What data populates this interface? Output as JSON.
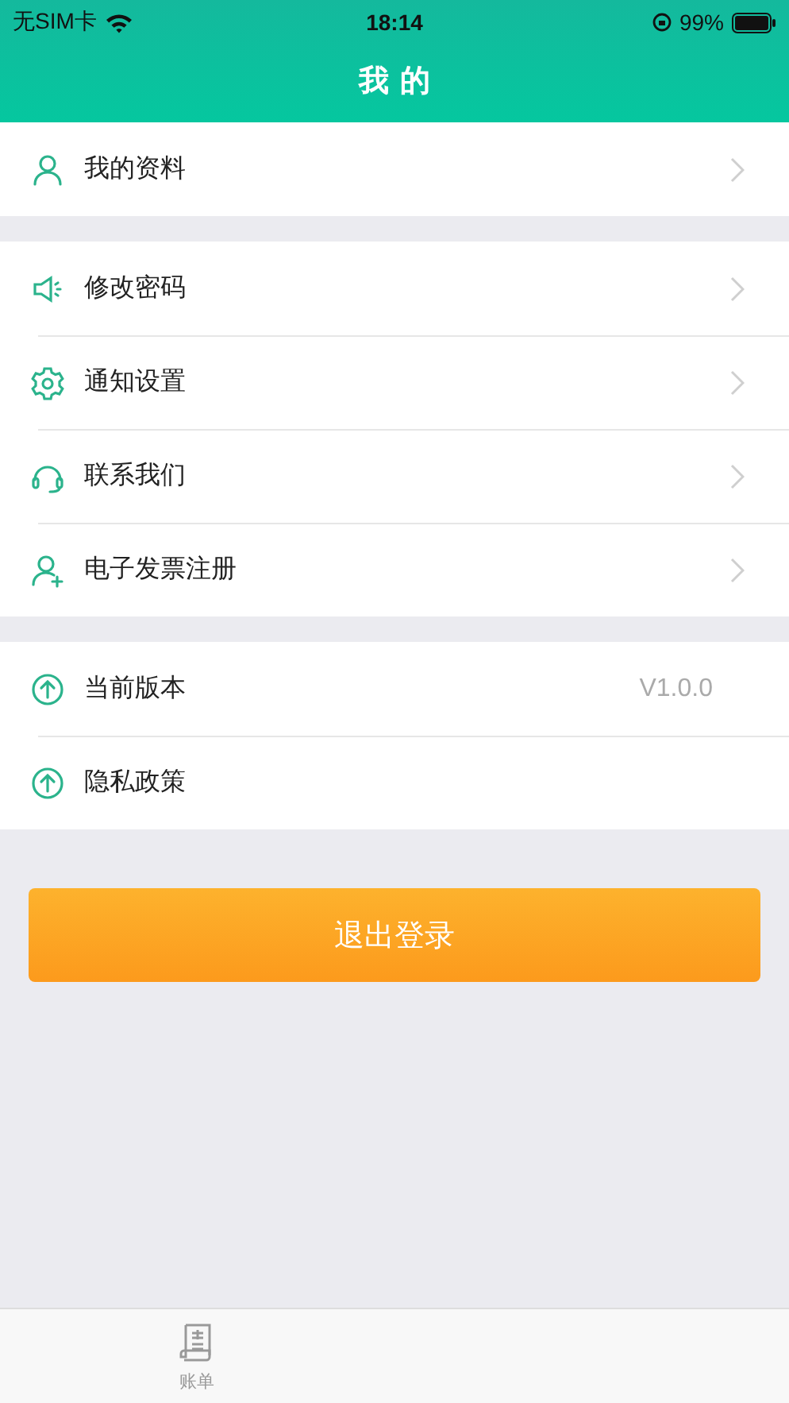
{
  "status_bar": {
    "carrier": "无SIM卡",
    "time": "18:14",
    "battery": "99%"
  },
  "header": {
    "title": "我 的"
  },
  "groups": [
    {
      "items": [
        {
          "label": "我的资料",
          "kind": "link"
        }
      ]
    },
    {
      "items": [
        {
          "label": "修改密码",
          "kind": "link"
        },
        {
          "label": "通知设置",
          "kind": "link"
        },
        {
          "label": "联系我们",
          "kind": "link"
        },
        {
          "label": "电子发票注册",
          "kind": "link"
        }
      ]
    },
    {
      "items": [
        {
          "label": "当前版本",
          "kind": "info",
          "value": "V1.0.0"
        },
        {
          "label": "隐私政策",
          "kind": "plain"
        }
      ]
    }
  ],
  "logout_button": "退出登录",
  "tabs": [
    {
      "label": "账单",
      "selected": false
    }
  ]
}
